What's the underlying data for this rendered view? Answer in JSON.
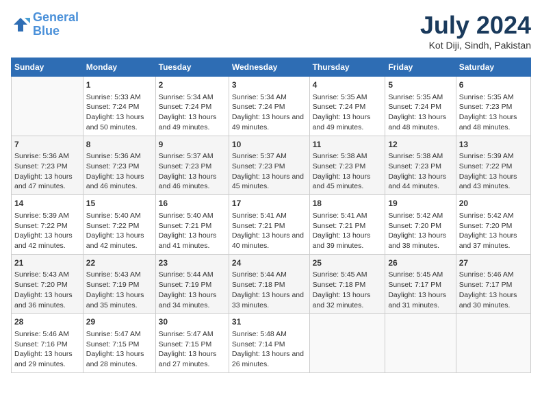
{
  "header": {
    "logo_line1": "General",
    "logo_line2": "Blue",
    "month_title": "July 2024",
    "location": "Kot Diji, Sindh, Pakistan"
  },
  "days_of_week": [
    "Sunday",
    "Monday",
    "Tuesday",
    "Wednesday",
    "Thursday",
    "Friday",
    "Saturday"
  ],
  "weeks": [
    [
      {
        "day": "",
        "sunrise": "",
        "sunset": "",
        "daylight": ""
      },
      {
        "day": "1",
        "sunrise": "Sunrise: 5:33 AM",
        "sunset": "Sunset: 7:24 PM",
        "daylight": "Daylight: 13 hours and 50 minutes."
      },
      {
        "day": "2",
        "sunrise": "Sunrise: 5:34 AM",
        "sunset": "Sunset: 7:24 PM",
        "daylight": "Daylight: 13 hours and 49 minutes."
      },
      {
        "day": "3",
        "sunrise": "Sunrise: 5:34 AM",
        "sunset": "Sunset: 7:24 PM",
        "daylight": "Daylight: 13 hours and 49 minutes."
      },
      {
        "day": "4",
        "sunrise": "Sunrise: 5:35 AM",
        "sunset": "Sunset: 7:24 PM",
        "daylight": "Daylight: 13 hours and 49 minutes."
      },
      {
        "day": "5",
        "sunrise": "Sunrise: 5:35 AM",
        "sunset": "Sunset: 7:24 PM",
        "daylight": "Daylight: 13 hours and 48 minutes."
      },
      {
        "day": "6",
        "sunrise": "Sunrise: 5:35 AM",
        "sunset": "Sunset: 7:23 PM",
        "daylight": "Daylight: 13 hours and 48 minutes."
      }
    ],
    [
      {
        "day": "7",
        "sunrise": "Sunrise: 5:36 AM",
        "sunset": "Sunset: 7:23 PM",
        "daylight": "Daylight: 13 hours and 47 minutes."
      },
      {
        "day": "8",
        "sunrise": "Sunrise: 5:36 AM",
        "sunset": "Sunset: 7:23 PM",
        "daylight": "Daylight: 13 hours and 46 minutes."
      },
      {
        "day": "9",
        "sunrise": "Sunrise: 5:37 AM",
        "sunset": "Sunset: 7:23 PM",
        "daylight": "Daylight: 13 hours and 46 minutes."
      },
      {
        "day": "10",
        "sunrise": "Sunrise: 5:37 AM",
        "sunset": "Sunset: 7:23 PM",
        "daylight": "Daylight: 13 hours and 45 minutes."
      },
      {
        "day": "11",
        "sunrise": "Sunrise: 5:38 AM",
        "sunset": "Sunset: 7:23 PM",
        "daylight": "Daylight: 13 hours and 45 minutes."
      },
      {
        "day": "12",
        "sunrise": "Sunrise: 5:38 AM",
        "sunset": "Sunset: 7:23 PM",
        "daylight": "Daylight: 13 hours and 44 minutes."
      },
      {
        "day": "13",
        "sunrise": "Sunrise: 5:39 AM",
        "sunset": "Sunset: 7:22 PM",
        "daylight": "Daylight: 13 hours and 43 minutes."
      }
    ],
    [
      {
        "day": "14",
        "sunrise": "Sunrise: 5:39 AM",
        "sunset": "Sunset: 7:22 PM",
        "daylight": "Daylight: 13 hours and 42 minutes."
      },
      {
        "day": "15",
        "sunrise": "Sunrise: 5:40 AM",
        "sunset": "Sunset: 7:22 PM",
        "daylight": "Daylight: 13 hours and 42 minutes."
      },
      {
        "day": "16",
        "sunrise": "Sunrise: 5:40 AM",
        "sunset": "Sunset: 7:21 PM",
        "daylight": "Daylight: 13 hours and 41 minutes."
      },
      {
        "day": "17",
        "sunrise": "Sunrise: 5:41 AM",
        "sunset": "Sunset: 7:21 PM",
        "daylight": "Daylight: 13 hours and 40 minutes."
      },
      {
        "day": "18",
        "sunrise": "Sunrise: 5:41 AM",
        "sunset": "Sunset: 7:21 PM",
        "daylight": "Daylight: 13 hours and 39 minutes."
      },
      {
        "day": "19",
        "sunrise": "Sunrise: 5:42 AM",
        "sunset": "Sunset: 7:20 PM",
        "daylight": "Daylight: 13 hours and 38 minutes."
      },
      {
        "day": "20",
        "sunrise": "Sunrise: 5:42 AM",
        "sunset": "Sunset: 7:20 PM",
        "daylight": "Daylight: 13 hours and 37 minutes."
      }
    ],
    [
      {
        "day": "21",
        "sunrise": "Sunrise: 5:43 AM",
        "sunset": "Sunset: 7:20 PM",
        "daylight": "Daylight: 13 hours and 36 minutes."
      },
      {
        "day": "22",
        "sunrise": "Sunrise: 5:43 AM",
        "sunset": "Sunset: 7:19 PM",
        "daylight": "Daylight: 13 hours and 35 minutes."
      },
      {
        "day": "23",
        "sunrise": "Sunrise: 5:44 AM",
        "sunset": "Sunset: 7:19 PM",
        "daylight": "Daylight: 13 hours and 34 minutes."
      },
      {
        "day": "24",
        "sunrise": "Sunrise: 5:44 AM",
        "sunset": "Sunset: 7:18 PM",
        "daylight": "Daylight: 13 hours and 33 minutes."
      },
      {
        "day": "25",
        "sunrise": "Sunrise: 5:45 AM",
        "sunset": "Sunset: 7:18 PM",
        "daylight": "Daylight: 13 hours and 32 minutes."
      },
      {
        "day": "26",
        "sunrise": "Sunrise: 5:45 AM",
        "sunset": "Sunset: 7:17 PM",
        "daylight": "Daylight: 13 hours and 31 minutes."
      },
      {
        "day": "27",
        "sunrise": "Sunrise: 5:46 AM",
        "sunset": "Sunset: 7:17 PM",
        "daylight": "Daylight: 13 hours and 30 minutes."
      }
    ],
    [
      {
        "day": "28",
        "sunrise": "Sunrise: 5:46 AM",
        "sunset": "Sunset: 7:16 PM",
        "daylight": "Daylight: 13 hours and 29 minutes."
      },
      {
        "day": "29",
        "sunrise": "Sunrise: 5:47 AM",
        "sunset": "Sunset: 7:15 PM",
        "daylight": "Daylight: 13 hours and 28 minutes."
      },
      {
        "day": "30",
        "sunrise": "Sunrise: 5:47 AM",
        "sunset": "Sunset: 7:15 PM",
        "daylight": "Daylight: 13 hours and 27 minutes."
      },
      {
        "day": "31",
        "sunrise": "Sunrise: 5:48 AM",
        "sunset": "Sunset: 7:14 PM",
        "daylight": "Daylight: 13 hours and 26 minutes."
      },
      {
        "day": "",
        "sunrise": "",
        "sunset": "",
        "daylight": ""
      },
      {
        "day": "",
        "sunrise": "",
        "sunset": "",
        "daylight": ""
      },
      {
        "day": "",
        "sunrise": "",
        "sunset": "",
        "daylight": ""
      }
    ]
  ]
}
